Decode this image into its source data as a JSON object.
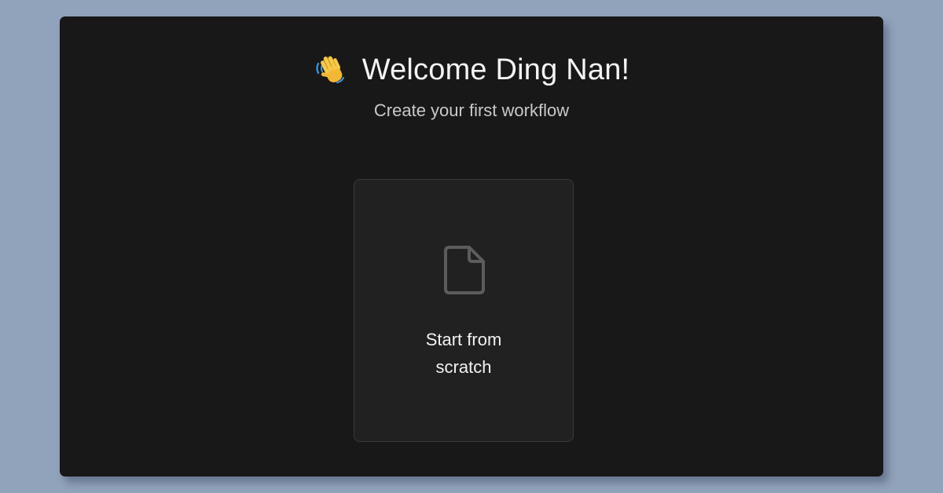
{
  "welcome": {
    "emoji_icon": "waving-hand-icon",
    "title": "Welcome Ding Nan!",
    "subtitle": "Create your first workflow"
  },
  "start_card": {
    "icon": "document-icon",
    "label": "Start from scratch"
  },
  "colors": {
    "page_background": "#91a2bb",
    "window_background": "#181818",
    "card_background": "#212121",
    "card_border": "#3a3a3a",
    "icon_stroke": "#5c5c5c"
  }
}
